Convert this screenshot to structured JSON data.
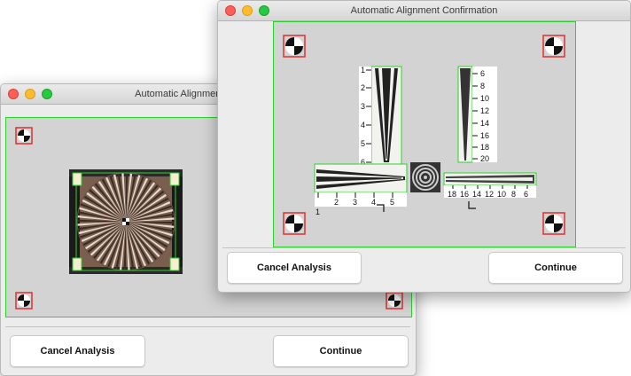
{
  "back_window": {
    "title": "Automatic Alignment Confirmation",
    "cancel_label": "Cancel Analysis",
    "continue_label": "Continue"
  },
  "front_window": {
    "title": "Automatic Alignment Confirmation",
    "cancel_label": "Cancel Analysis",
    "continue_label": "Continue",
    "vertical_scale_left": [
      "1",
      "2",
      "3",
      "4",
      "5",
      "6"
    ],
    "vertical_scale_right": [
      "6",
      "8",
      "10",
      "12",
      "14",
      "16",
      "18",
      "20"
    ],
    "horizontal_scale_left": [
      "1",
      "2",
      "3",
      "4",
      "5"
    ],
    "horizontal_scale_right": [
      "18",
      "16",
      "14",
      "12",
      "10",
      "8",
      "6"
    ]
  },
  "colors": {
    "highlight": "#30d030",
    "fiducial_border": "#e03030"
  }
}
